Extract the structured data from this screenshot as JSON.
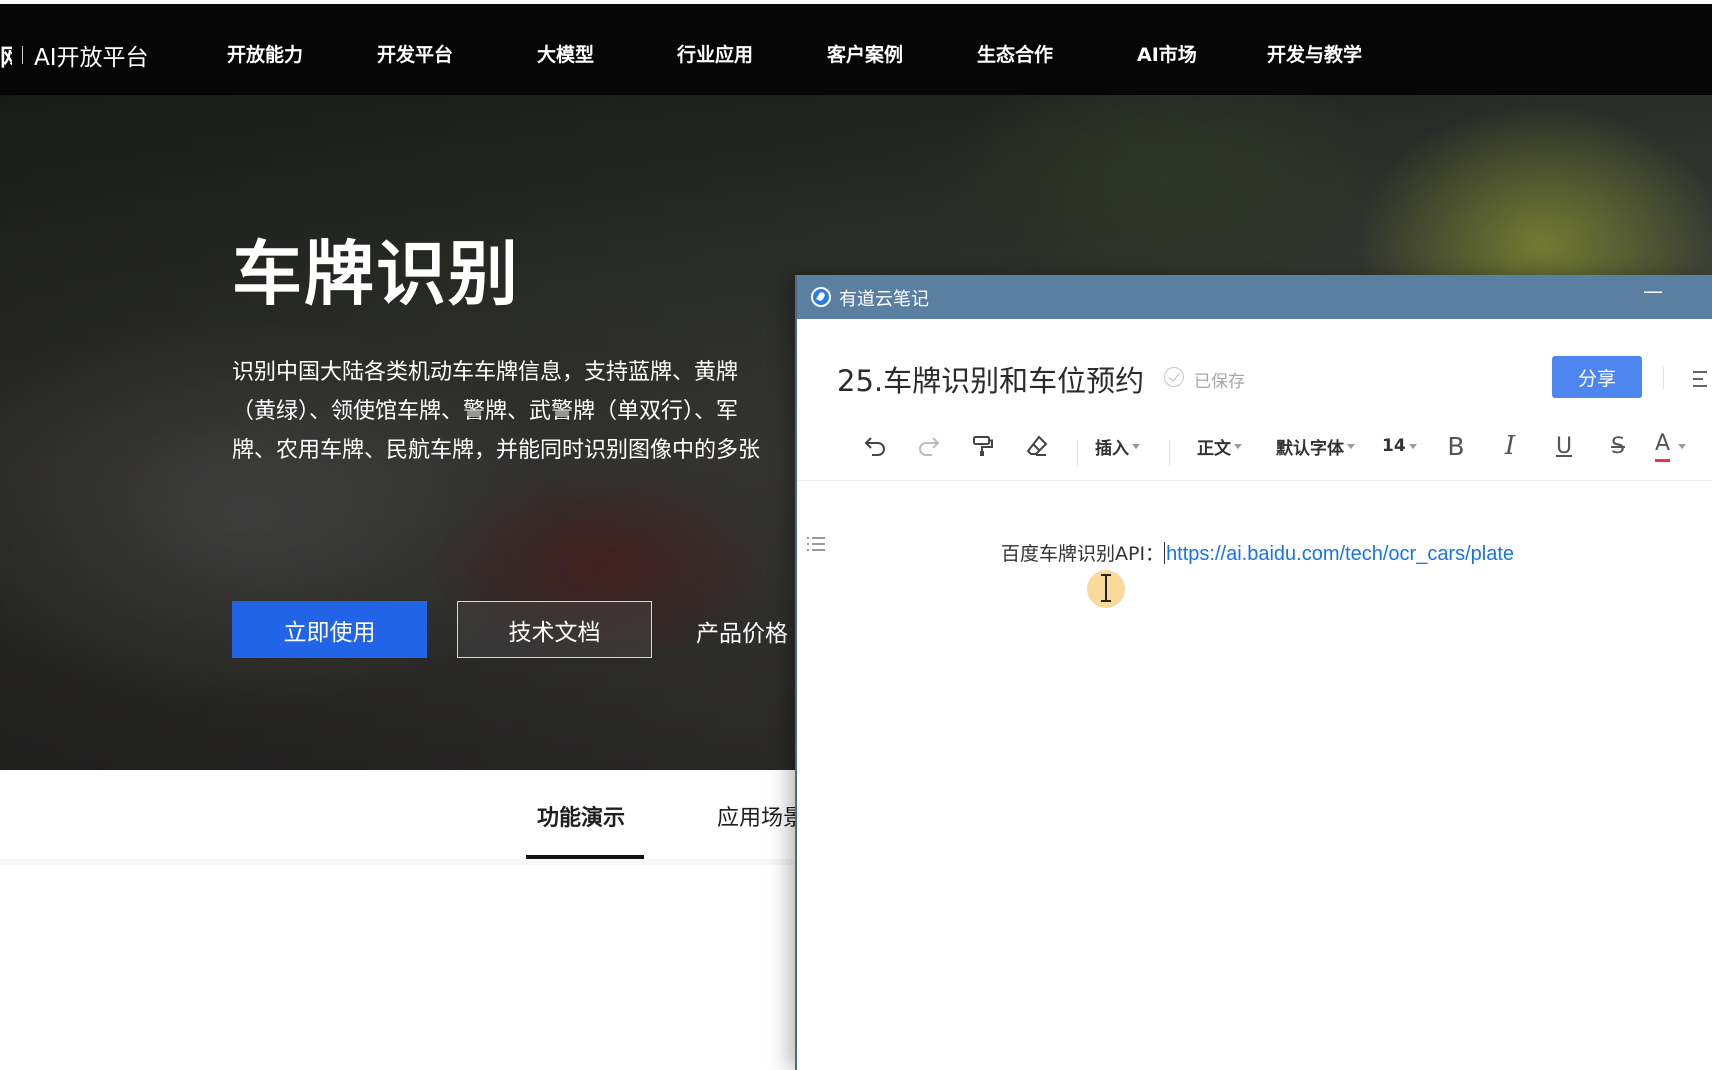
{
  "site": {
    "logo_cut_text": "网",
    "logo_text": "AI开放平台",
    "nav": [
      "开放能力",
      "开发平台",
      "大模型",
      "行业应用",
      "客户案例",
      "生态合作",
      "AI市场",
      "开发与教学"
    ]
  },
  "hero": {
    "title": "车牌识别",
    "description_lines": [
      "识别中国大陆各类机动车车牌信息，支持蓝牌、黄牌",
      "（黄绿）、领使馆车牌、警牌、武警牌（单双行）、军",
      "牌、农用车牌、民航车牌，并能同时识别图像中的多张"
    ],
    "primary_button": "立即使用",
    "secondary_button": "技术文档",
    "price_link": "产品价格"
  },
  "tabs": {
    "items": [
      "功能演示",
      "应用场景"
    ],
    "active": "功能演示"
  },
  "note_app": {
    "app_name": "有道云笔记",
    "minimize_symbol": "—",
    "doc_title": "25.车牌识别和车位预约",
    "saved_status": "已保存",
    "share_button": "分享",
    "toolbar": {
      "insert": "插入",
      "paragraph_style": "正文",
      "font_family": "默认字体",
      "font_size": "14",
      "bold": "B",
      "italic": "I",
      "underline": "U",
      "strikethrough": "S",
      "font_color": "A"
    },
    "content": {
      "label": "百度车牌识别API：",
      "link": "https://ai.baidu.com/tech/ocr_cars/plate"
    }
  },
  "colors": {
    "nav_background": "#060606",
    "primary_blue": "#2164e8",
    "note_titlebar": "#5b7fa1",
    "share_blue": "#4e86f0",
    "link_blue": "#1a73e8",
    "font_color_underline": "#e53935"
  }
}
